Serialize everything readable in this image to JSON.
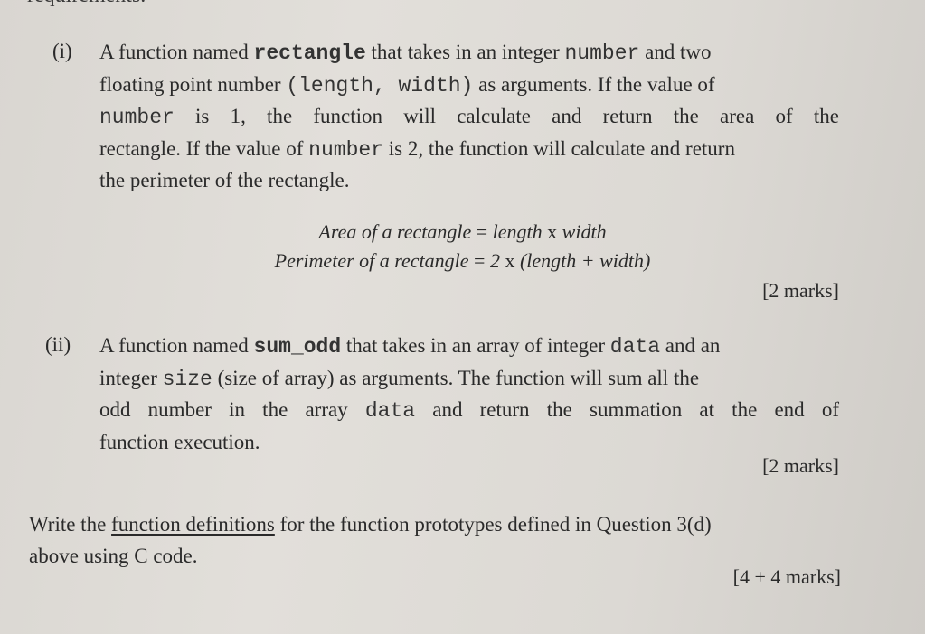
{
  "header_fragment": "requirements.",
  "part_i": {
    "label": "(i)",
    "line1_pre": "A function named ",
    "line1_func": "rectangle",
    "line1_mid": " that takes in an integer ",
    "line1_var": "number",
    "line1_post": " and two",
    "line2_pre": "floating point number ",
    "line2_args": "(length, width)",
    "line2_post": " as arguments. If the value of",
    "line3_var": "number",
    "line3_post": " is 1, the function will calculate and return the area of the",
    "line4_pre": "rectangle. If the value of ",
    "line4_var": "number",
    "line4_post": " is 2, the function will calculate and return",
    "line5": "the perimeter of the rectangle.",
    "formula_area": {
      "lhs": "Area of a rectangle",
      "eq": " = ",
      "rhs_a": "length",
      "times": " x ",
      "rhs_b": "width"
    },
    "formula_perimeter": {
      "lhs": "Perimeter of a rectangle",
      "eq": " = ",
      "two": "2",
      "times": " x ",
      "rhs": "(length + width)"
    },
    "marks": "[2 marks]"
  },
  "part_ii": {
    "label": "(ii)",
    "line1_pre": "A function named ",
    "line1_func": "sum_odd",
    "line1_mid": " that takes in an array of integer ",
    "line1_var": "data",
    "line1_post": " and an",
    "line2_pre": "integer ",
    "line2_var": "size",
    "line2_post": " (size of array) as arguments. The function will sum all the",
    "line3_pre": "odd number in the array ",
    "line3_var": "data",
    "line3_post": " and return the summation at the end of",
    "line4": "function execution.",
    "marks": "[2 marks]"
  },
  "instruction": {
    "pre": "Write the ",
    "underlined": "function definitions",
    "post": " for the function prototypes defined in Question 3(d)",
    "line2": "above using C code.",
    "marks": "[4 + 4 marks]"
  }
}
